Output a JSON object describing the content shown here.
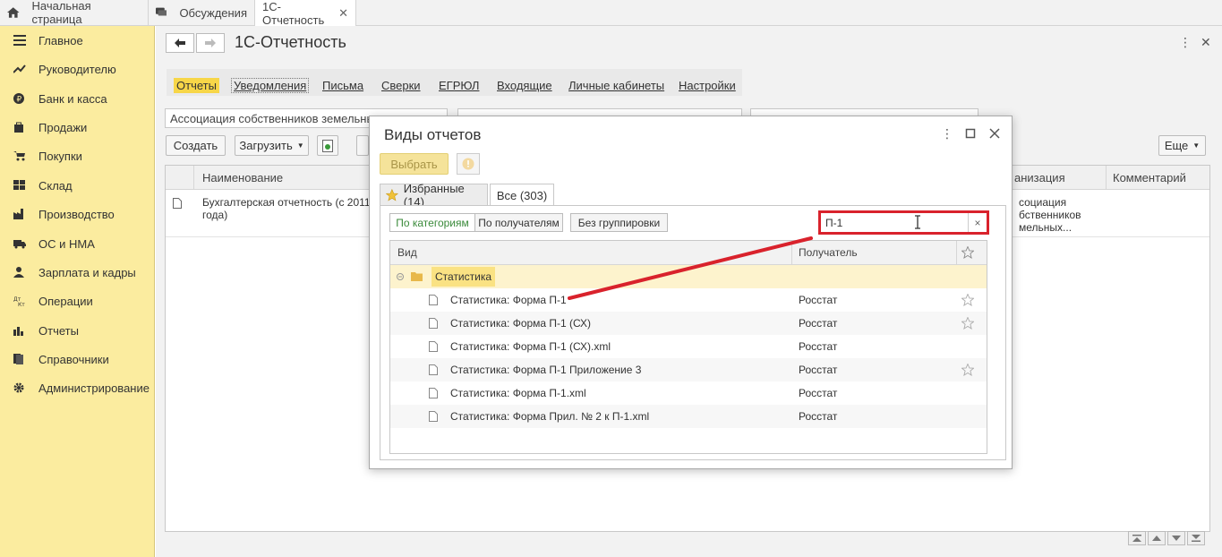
{
  "top_tabs": [
    {
      "label": "Начальная страница",
      "icon": "home-icon"
    },
    {
      "label": "Обсуждения",
      "icon": "chat-icon"
    },
    {
      "label": "1С-Отчетность",
      "icon": "close-icon"
    }
  ],
  "sidebar": {
    "items": [
      {
        "label": "Главное",
        "icon": "menu-icon"
      },
      {
        "label": "Руководителю",
        "icon": "trend-icon"
      },
      {
        "label": "Банк и касса",
        "icon": "coin-icon"
      },
      {
        "label": "Продажи",
        "icon": "bag-icon"
      },
      {
        "label": "Покупки",
        "icon": "cart-icon"
      },
      {
        "label": "Склад",
        "icon": "boxes-icon"
      },
      {
        "label": "Производство",
        "icon": "factory-icon"
      },
      {
        "label": "ОС и НМА",
        "icon": "truck-icon"
      },
      {
        "label": "Зарплата и кадры",
        "icon": "person-icon"
      },
      {
        "label": "Операции",
        "icon": "dt-kt-icon"
      },
      {
        "label": "Отчеты",
        "icon": "bar-chart-icon"
      },
      {
        "label": "Справочники",
        "icon": "book-icon"
      },
      {
        "label": "Администрирование",
        "icon": "gear-icon"
      }
    ]
  },
  "main": {
    "title": "1С-Отчетность",
    "links": [
      "Отчеты",
      "Уведомления",
      "Письма",
      "Сверки",
      "ЕГРЮЛ",
      "Входящие",
      "Личные кабинеты",
      "Настройки"
    ],
    "org_filter": "Ассоциация собственников земельных у",
    "buttons": {
      "create": "Создать",
      "load": "Загрузить",
      "more": "Еще"
    },
    "grid": {
      "columns": [
        "Наименование",
        "анизация",
        "Комментарий"
      ],
      "row": {
        "name_line1": "Бухгалтерская отчетность (с 2011",
        "name_line2": "года)",
        "org_line1": "социация",
        "org_line2": "бственников",
        "org_line3": "мельных..."
      }
    }
  },
  "modal": {
    "title": "Виды отчетов",
    "select_button": "Выбрать",
    "tabs": [
      "Избранные (14)",
      "Все (303)"
    ],
    "grouping": [
      "По категориям",
      "По получателям",
      "Без группировки"
    ],
    "search_value": "П-1",
    "search_clear": "×",
    "columns": {
      "kind": "Вид",
      "recipient": "Получатель"
    },
    "group_label": "Статистика",
    "rows": [
      {
        "kind": "Статистика: Форма П-1",
        "recipient": "Росстат",
        "star": true
      },
      {
        "kind": "Статистика: Форма П-1 (СХ)",
        "recipient": "Росстат",
        "star": true
      },
      {
        "kind": "Статистика: Форма П-1 (СХ).xml",
        "recipient": "Росстат",
        "star": false
      },
      {
        "kind": "Статистика: Форма П-1 Приложение 3",
        "recipient": "Росстат",
        "star": true
      },
      {
        "kind": "Статистика: Форма П-1.xml",
        "recipient": "Росстат",
        "star": false
      },
      {
        "kind": "Статистика: Форма Прил. № 2 к П-1.xml",
        "recipient": "Росстат",
        "star": false
      }
    ]
  },
  "colors": {
    "accent_yellow": "#f7d648",
    "sidebar": "#fbec9f",
    "annotation_red": "#d9222c",
    "active_green": "#3a8a3a"
  }
}
